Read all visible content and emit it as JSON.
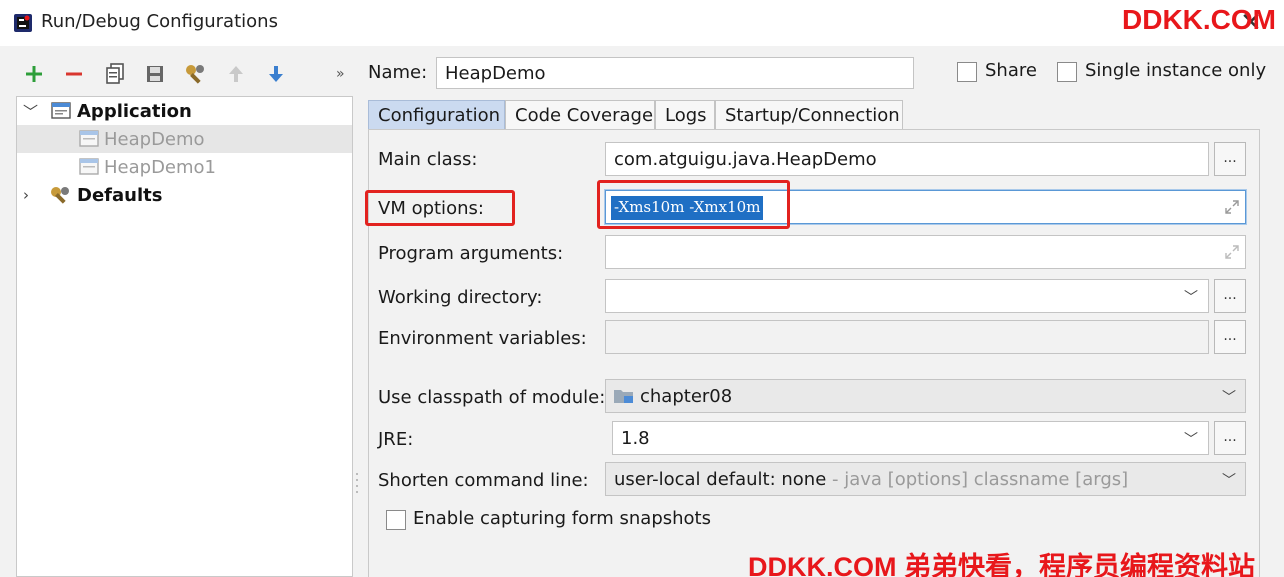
{
  "window": {
    "title": "Run/Debug Configurations",
    "watermark": "DDKK.COM",
    "watermark_bottom": "DDKK.COM 弟弟快看，程序员编程资料站"
  },
  "toolbar": {
    "add": "+",
    "remove": "−",
    "more": "»"
  },
  "tree": {
    "items": [
      {
        "label": "Application",
        "expanded": true
      },
      {
        "label": "HeapDemo",
        "selected": true
      },
      {
        "label": "HeapDemo1"
      },
      {
        "label": "Defaults",
        "expanded": false
      }
    ]
  },
  "config": {
    "name_label": "Name:",
    "name_value": "HeapDemo",
    "share_label": "Share",
    "single_instance_label": "Single instance only",
    "tabs": [
      {
        "label": "Configuration",
        "active": true
      },
      {
        "label": "Code Coverage"
      },
      {
        "label": "Logs"
      },
      {
        "label": "Startup/Connection"
      }
    ],
    "main_class_label": "Main class:",
    "main_class_value": "com.atguigu.java.HeapDemo",
    "vm_options_label": "VM options:",
    "vm_options_value": "-Xms10m -Xmx10m",
    "program_args_label": "Program arguments:",
    "program_args_value": "",
    "working_dir_label": "Working directory:",
    "working_dir_value": "",
    "env_vars_label": "Environment variables:",
    "env_vars_value": "",
    "classpath_label": "Use classpath of module:",
    "classpath_value": "chapter08",
    "jre_label": "JRE:",
    "jre_value": "1.8",
    "shorten_label": "Shorten command line:",
    "shorten_value": "user-local default: none",
    "shorten_hint": " - java [options] classname [args]",
    "snapshots_label": "Enable capturing form snapshots",
    "dots": "..."
  },
  "colors": {
    "accent_red": "#e2221f",
    "selection_blue": "#1f6fc4",
    "active_tab": "#cbdaf0"
  }
}
